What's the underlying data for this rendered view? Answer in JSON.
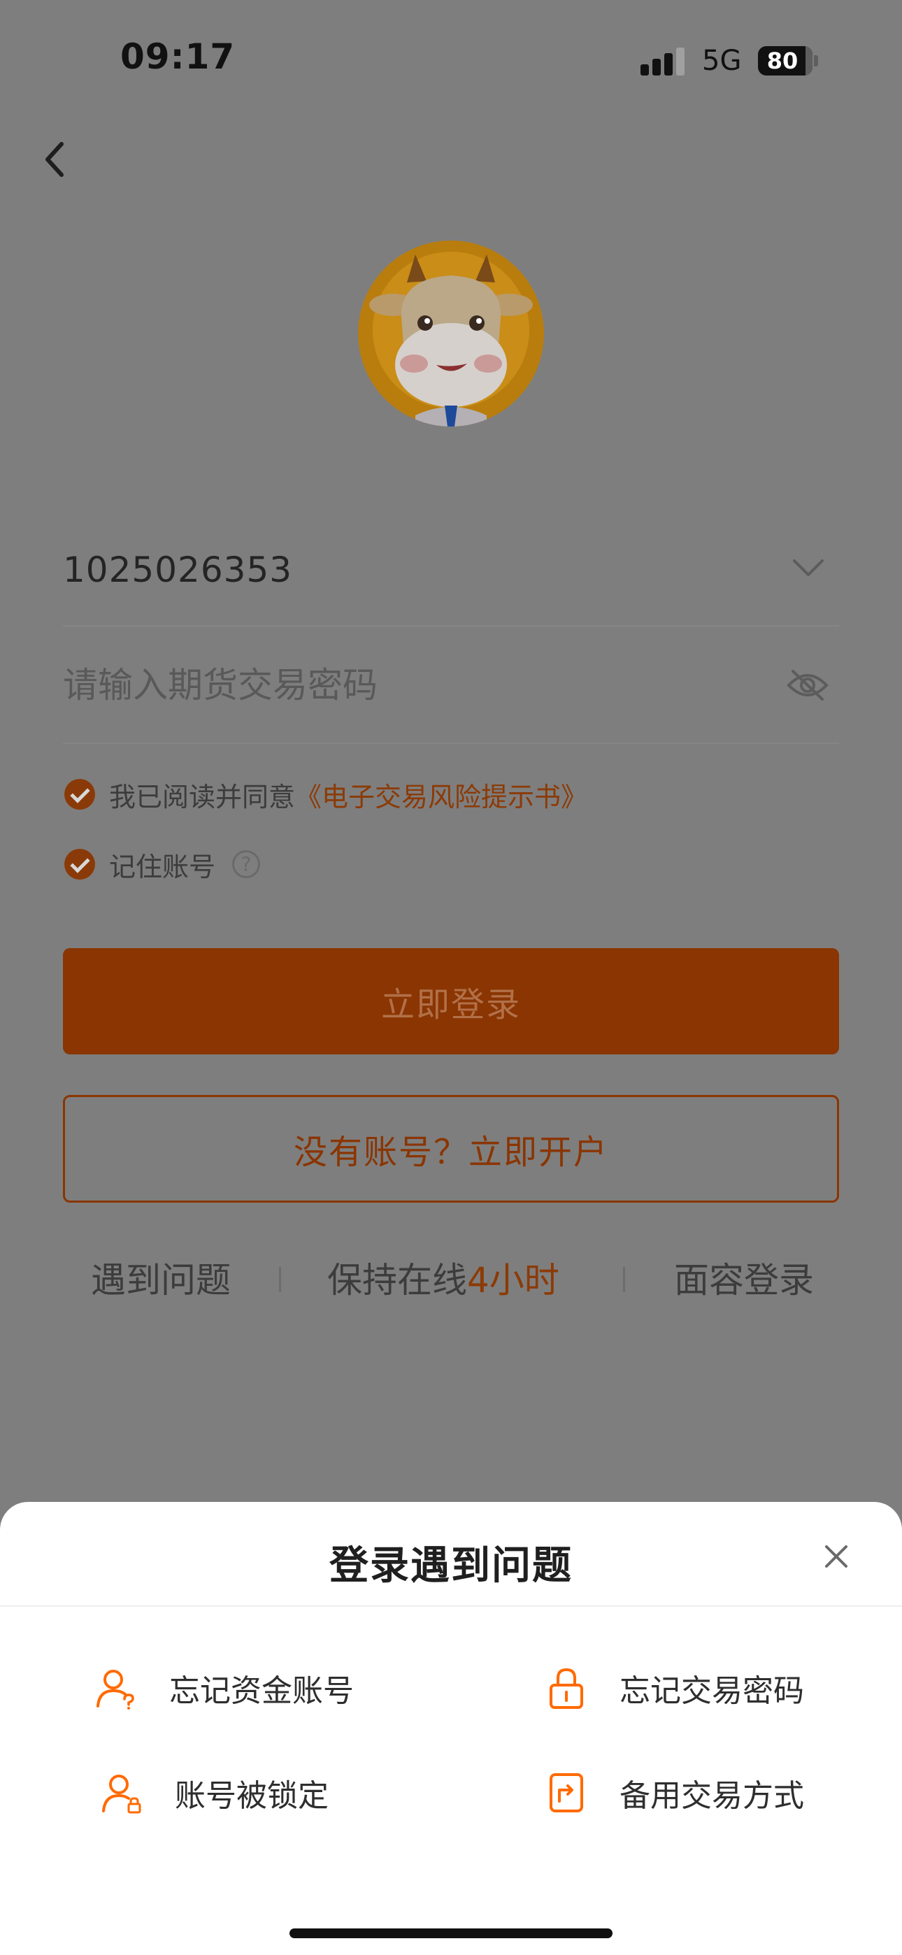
{
  "status": {
    "time": "09:17",
    "network": "5G",
    "battery": "80"
  },
  "account": {
    "value": "1025026353"
  },
  "password": {
    "placeholder": "请输入期货交易密码"
  },
  "agreement": {
    "prefix": "我已阅读并同意",
    "link": "《电子交易风险提示书》"
  },
  "remember": {
    "label": "记住账号",
    "help": "?"
  },
  "buttons": {
    "login": "立即登录",
    "open_account": "没有账号？立即开户"
  },
  "links": {
    "problem": "遇到问题",
    "keep_online_prefix": "保持在线",
    "keep_online_hours": "4小时",
    "face_login": "面容登录"
  },
  "sheet": {
    "title": "登录遇到问题",
    "options": [
      {
        "label": "忘记资金账号",
        "icon": "user-question-icon"
      },
      {
        "label": "忘记交易密码",
        "icon": "lock-icon"
      },
      {
        "label": "账号被锁定",
        "icon": "user-lock-icon"
      },
      {
        "label": "备用交易方式",
        "icon": "backup-icon"
      }
    ]
  },
  "colors": {
    "accent": "#ff6a00",
    "overlay_accent": "#8a3502",
    "sheet_bg": "#ffffff"
  }
}
